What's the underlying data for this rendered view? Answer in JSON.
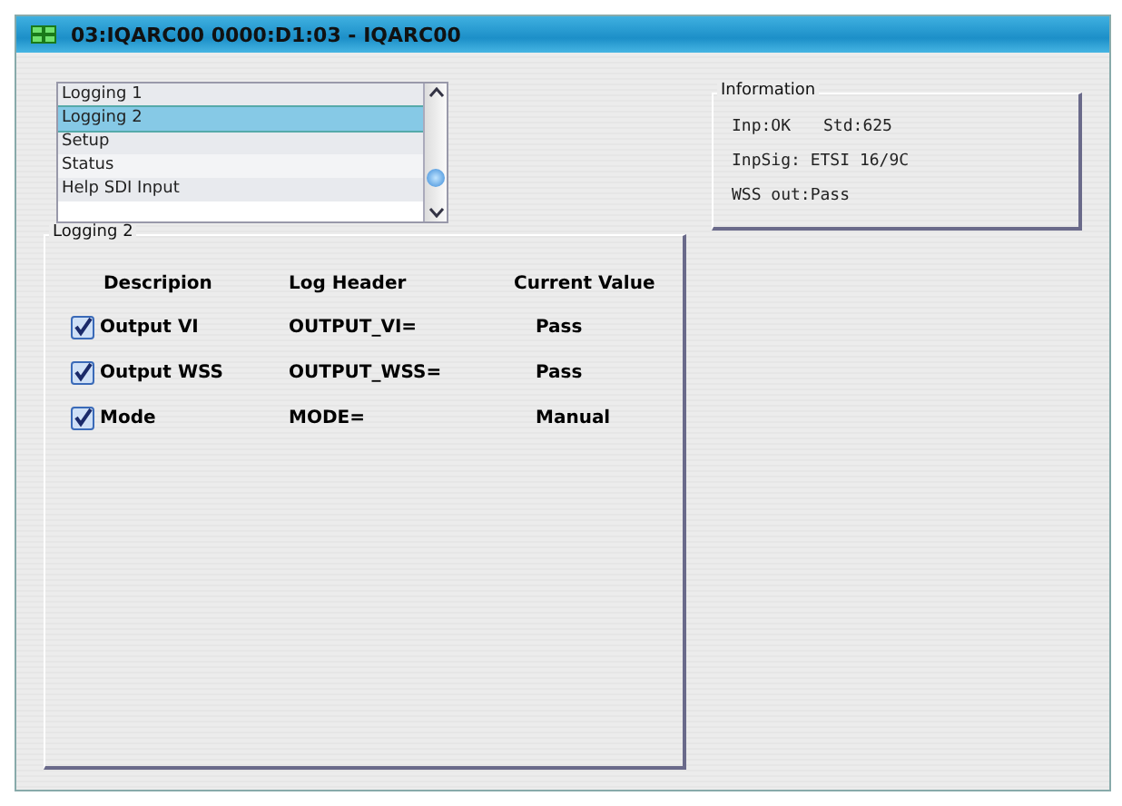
{
  "window": {
    "title": "03:IQARC00  0000:D1:03  - IQARC00"
  },
  "list": {
    "items": [
      {
        "label": "Logging 1",
        "selected": false
      },
      {
        "label": "Logging 2",
        "selected": true
      },
      {
        "label": "Setup",
        "selected": false
      },
      {
        "label": "Status",
        "selected": false
      },
      {
        "label": "Help SDI Input",
        "selected": false
      }
    ]
  },
  "logging_group": {
    "title": "Logging 2",
    "columns": [
      "Descripion",
      "Log Header",
      "Current Value"
    ],
    "rows": [
      {
        "description": "Output VI",
        "checked": true,
        "log_header": "OUTPUT_VI=",
        "current_value": "Pass"
      },
      {
        "description": "Output WSS",
        "checked": true,
        "log_header": "OUTPUT_WSS=",
        "current_value": "Pass"
      },
      {
        "description": "Mode",
        "checked": true,
        "log_header": "MODE=",
        "current_value": "Manual"
      }
    ]
  },
  "information": {
    "title": "Information",
    "lines": [
      [
        "Inp:OK",
        "Std:625"
      ],
      [
        "InpSig: ETSI 16/9C"
      ],
      [
        "WSS out:Pass"
      ]
    ]
  }
}
